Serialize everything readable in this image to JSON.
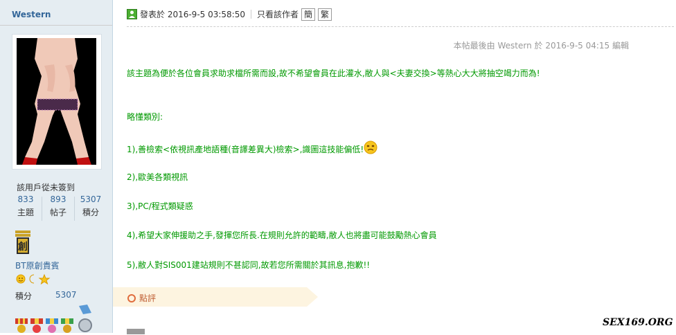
{
  "author": {
    "name": "Western",
    "signin_status": "該用戶從未簽到",
    "stats": [
      {
        "value": "833",
        "label": "主題"
      },
      {
        "value": "893",
        "label": "帖子"
      },
      {
        "value": "5307",
        "label": "積分"
      }
    ],
    "usergroup": "BT原創貴賓",
    "score_label": "積分",
    "score_value": "5307"
  },
  "post": {
    "posted_at": "發表於 2016-9-5 03:58:50",
    "author_only": "只看該作者",
    "simplified_btn": "簡",
    "traditional_btn": "繁",
    "last_edit": "本帖最後由 Western 於 2016-9-5 04:15 編輯",
    "paragraphs": [
      "該主題為便於各位會員求助求檔所需而設,故不希望會員在此灌水,敝人與<夫妻交換>等熱心大大將抽空竭力而為!",
      "略懂類別:",
      "1),善檢索<依視訊產地語種(音譯差異大)檢索>,識圖這技能偏低!",
      "2),歐美各類視訊",
      "3),PC/程式類疑惑",
      "4),希望大家伸援助之手,發揮您所長.在規則允許的範疇,敝人也將盡可能鼓勵熱心會員",
      "5),敝人對SIS001建站規則不甚認同,故若您所需關於其訊息,抱歉!!"
    ],
    "rate_label": "點評"
  },
  "watermark": "SEX169.ORG",
  "colors": {
    "content_green": "#009900",
    "link_blue": "#336699",
    "sidebar_bg": "#e5edf2",
    "rate_bar_bg": "#fdf4e0"
  }
}
